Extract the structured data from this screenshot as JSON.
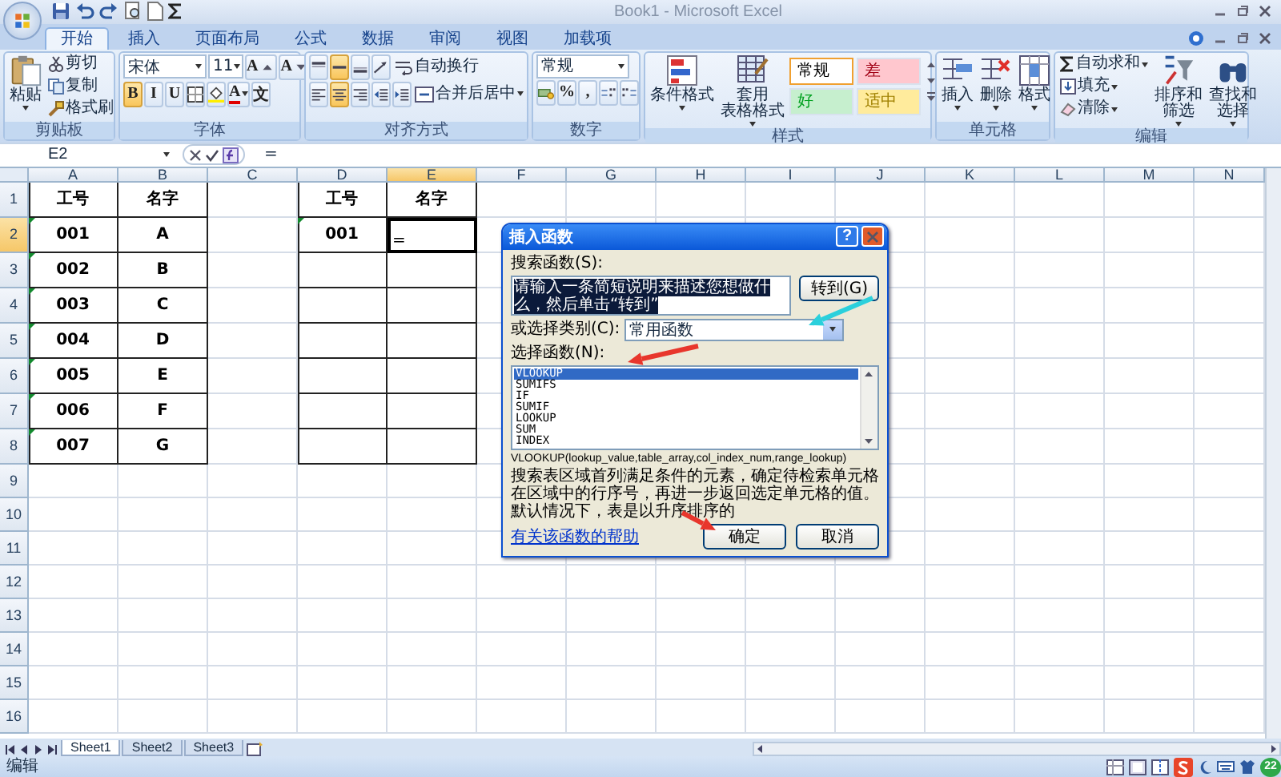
{
  "window": {
    "title": "Book1 - Microsoft Excel"
  },
  "ribbon_tabs": [
    {
      "label": "开始",
      "selected": true
    },
    {
      "label": "插入",
      "selected": false
    },
    {
      "label": "页面布局",
      "selected": false
    },
    {
      "label": "公式",
      "selected": false
    },
    {
      "label": "数据",
      "selected": false
    },
    {
      "label": "审阅",
      "selected": false
    },
    {
      "label": "视图",
      "selected": false
    },
    {
      "label": "加载项",
      "selected": false
    }
  ],
  "ribbon_groups": [
    {
      "kind": "clipboard",
      "title": "剪贴板",
      "paste_label": "粘贴",
      "items": [
        "剪切",
        "复制",
        "格式刷"
      ]
    },
    {
      "kind": "font",
      "title": "字体",
      "font_name": "宋体",
      "font_size": "11",
      "grow_label": "A",
      "shrink_label": "A",
      "style_buttons": [
        {
          "label": "B",
          "selected": true
        },
        {
          "label": "I",
          "selected": false
        },
        {
          "label": "U",
          "selected": false
        }
      ],
      "font_color_label": "A",
      "phonetic_label": "文"
    },
    {
      "kind": "alignment",
      "title": "对齐方式",
      "wrap_label": "自动换行",
      "merge_label": "合并后居中",
      "vertical_buttons": [
        {
          "selected": false
        },
        {
          "selected": true
        },
        {
          "selected": false
        }
      ],
      "horizontal_buttons": [
        {
          "selected": false
        },
        {
          "selected": true
        },
        {
          "selected": false
        }
      ]
    },
    {
      "kind": "number",
      "title": "数字",
      "format": "常规",
      "percent_label": "%",
      "comma_label": ","
    },
    {
      "kind": "styles",
      "title": "样式",
      "conditional_label": "条件格式",
      "table_label": [
        "套用",
        "表格格式"
      ],
      "cell_styles": [
        {
          "label": "常规",
          "color": "#ffffff",
          "selected": true
        },
        {
          "label": "差",
          "color": "#ffc7ce",
          "selected": false
        },
        {
          "label": "好",
          "color": "#c6efce",
          "selected": false
        },
        {
          "label": "适中",
          "color": "#ffeb9c",
          "selected": false
        }
      ]
    },
    {
      "kind": "cells",
      "title": "单元格",
      "items": [
        "插入",
        "删除",
        "格式"
      ]
    },
    {
      "kind": "editing",
      "title": "编辑",
      "small_items": [
        "自动求和",
        "填充",
        "清除"
      ],
      "large_items": [
        [
          "排序和",
          "筛选"
        ],
        [
          "查找和",
          "选择"
        ]
      ]
    }
  ],
  "formula_bar": {
    "name_box": "E2",
    "formula": "="
  },
  "sheet": {
    "columns": [
      {
        "label": "A",
        "selected": false
      },
      {
        "label": "B",
        "selected": false
      },
      {
        "label": "C",
        "selected": false
      },
      {
        "label": "D",
        "selected": false
      },
      {
        "label": "E",
        "selected": true
      },
      {
        "label": "F",
        "selected": false
      },
      {
        "label": "G",
        "selected": false
      },
      {
        "label": "H",
        "selected": false
      },
      {
        "label": "I",
        "selected": false
      },
      {
        "label": "J",
        "selected": false
      },
      {
        "label": "K",
        "selected": false
      },
      {
        "label": "L",
        "selected": false
      },
      {
        "label": "M",
        "selected": false
      },
      {
        "label": "N",
        "selected": false
      }
    ],
    "rows": [
      {
        "label": "1",
        "selected": false,
        "cells": [
          {
            "text": "工号",
            "bordered": true,
            "flagged": false,
            "selected": false
          },
          {
            "text": "名字",
            "bordered": true,
            "flagged": false,
            "selected": false
          },
          null,
          {
            "text": "工号",
            "bordered": true,
            "flagged": false,
            "selected": false
          },
          {
            "text": "名字",
            "bordered": true,
            "flagged": false,
            "selected": false
          }
        ]
      },
      {
        "label": "2",
        "selected": true,
        "cells": [
          {
            "text": "001",
            "bordered": true,
            "flagged": true,
            "selected": false
          },
          {
            "text": "A",
            "bordered": true,
            "flagged": false,
            "selected": false
          },
          null,
          {
            "text": "001",
            "bordered": true,
            "flagged": true,
            "selected": false
          },
          {
            "text": "=",
            "bordered": true,
            "flagged": false,
            "selected": true
          }
        ]
      },
      {
        "label": "3",
        "selected": false,
        "cells": [
          {
            "text": "002",
            "bordered": true,
            "flagged": true,
            "selected": false
          },
          {
            "text": "B",
            "bordered": true,
            "flagged": false,
            "selected": false
          },
          null,
          {
            "bordered": true,
            "flagged": false,
            "selected": false
          },
          {
            "bordered": true,
            "flagged": false,
            "selected": false
          }
        ]
      },
      {
        "label": "4",
        "selected": false,
        "cells": [
          {
            "text": "003",
            "bordered": true,
            "flagged": true,
            "selected": false
          },
          {
            "text": "C",
            "bordered": true,
            "flagged": false,
            "selected": false
          },
          null,
          {
            "bordered": true,
            "flagged": false,
            "selected": false
          },
          {
            "bordered": true,
            "flagged": false,
            "selected": false
          }
        ]
      },
      {
        "label": "5",
        "selected": false,
        "cells": [
          {
            "text": "004",
            "bordered": true,
            "flagged": true,
            "selected": false
          },
          {
            "text": "D",
            "bordered": true,
            "flagged": false,
            "selected": false
          },
          null,
          {
            "bordered": true,
            "flagged": false,
            "selected": false
          },
          {
            "bordered": true,
            "flagged": false,
            "selected": false
          }
        ]
      },
      {
        "label": "6",
        "selected": false,
        "cells": [
          {
            "text": "005",
            "bordered": true,
            "flagged": true,
            "selected": false
          },
          {
            "text": "E",
            "bordered": true,
            "flagged": false,
            "selected": false
          },
          null,
          {
            "bordered": true,
            "flagged": false,
            "selected": false
          },
          {
            "bordered": true,
            "flagged": false,
            "selected": false
          }
        ]
      },
      {
        "label": "7",
        "selected": false,
        "cells": [
          {
            "text": "006",
            "bordered": true,
            "flagged": true,
            "selected": false
          },
          {
            "text": "F",
            "bordered": true,
            "flagged": false,
            "selected": false
          },
          null,
          {
            "bordered": true,
            "flagged": false,
            "selected": false
          },
          {
            "bordered": true,
            "flagged": false,
            "selected": false
          }
        ]
      },
      {
        "label": "8",
        "selected": false,
        "cells": [
          {
            "text": "007",
            "bordered": true,
            "flagged": true,
            "selected": false
          },
          {
            "text": "G",
            "bordered": true,
            "flagged": false,
            "selected": false
          },
          null,
          {
            "bordered": true,
            "flagged": false,
            "selected": false
          },
          {
            "bordered": true,
            "flagged": false,
            "selected": false
          }
        ]
      },
      {
        "label": "9",
        "selected": false
      },
      {
        "label": "10",
        "selected": false
      },
      {
        "label": "11",
        "selected": false
      },
      {
        "label": "12",
        "selected": false
      },
      {
        "label": "13",
        "selected": false
      },
      {
        "label": "14",
        "selected": false
      },
      {
        "label": "15",
        "selected": false
      },
      {
        "label": "16",
        "selected": false
      }
    ]
  },
  "dialog": {
    "title": "插入函数",
    "help_button": "?",
    "search_label": "搜索函数(S):",
    "search_value": "请输入一条简短说明来描述您想做什么，然后单击“转到”",
    "go_button": "转到(G)",
    "category_label": "或选择类别(C):",
    "category_value": "常用函数",
    "list_label": "选择函数(N):",
    "functions": [
      {
        "name": "VLOOKUP",
        "selected": true
      },
      {
        "name": "SUMIFS",
        "selected": false
      },
      {
        "name": "IF",
        "selected": false
      },
      {
        "name": "SUMIF",
        "selected": false
      },
      {
        "name": "LOOKUP",
        "selected": false
      },
      {
        "name": "SUM",
        "selected": false
      },
      {
        "name": "INDEX",
        "selected": false
      }
    ],
    "signature": "VLOOKUP(lookup_value,table_array,col_index_num,range_lookup)",
    "description": "搜索表区域首列满足条件的元素，确定待检索单元格在区域中的行序号，再进一步返回选定单元格的值。默认情况下，表是以升序排序的",
    "help_link": "有关该函数的帮助",
    "ok_button": "确定",
    "cancel_button": "取消"
  },
  "sheet_tabs": [
    {
      "label": "Sheet1",
      "selected": true
    },
    {
      "label": "Sheet2",
      "selected": false
    },
    {
      "label": "Sheet3",
      "selected": false
    }
  ],
  "status_bar": {
    "mode": "编辑",
    "badge": "22"
  },
  "annotation_arrows": [
    {
      "color": "#e8362c"
    },
    {
      "color": "#2bd0dc"
    },
    {
      "color": "#e8362c"
    }
  ]
}
